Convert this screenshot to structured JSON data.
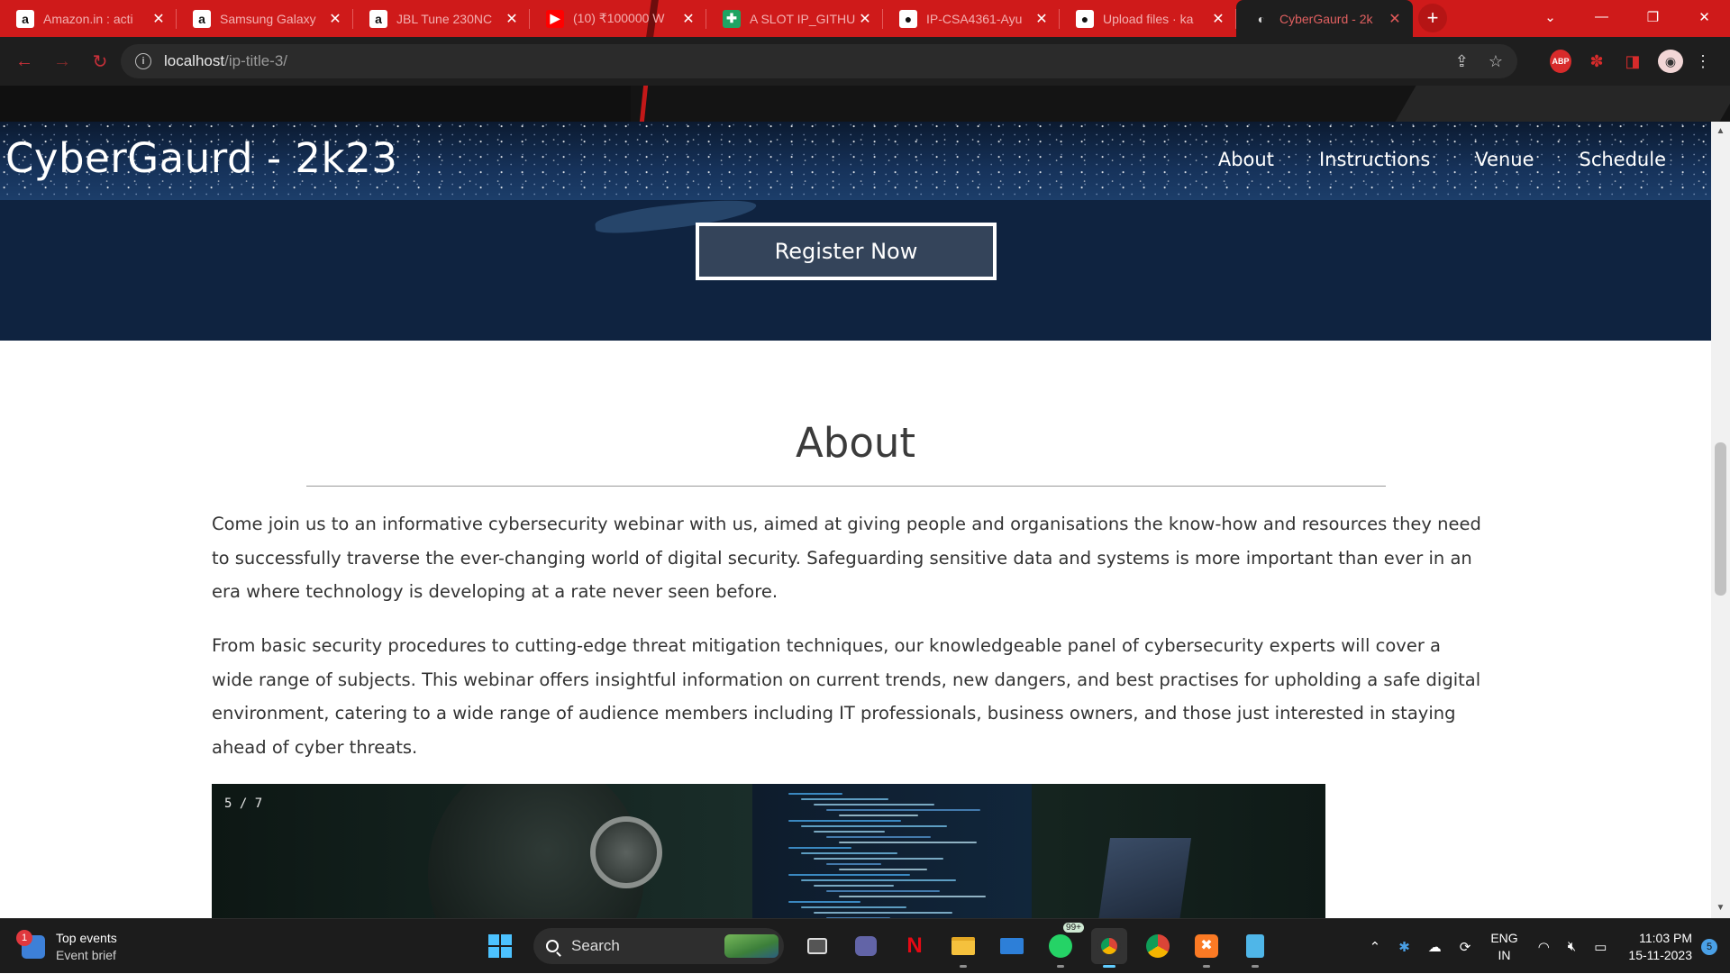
{
  "browser": {
    "tabs": [
      {
        "title": "Amazon.in : acti",
        "favicon": "amazon-icon",
        "fav_bg": "#ffffff",
        "fav_fg": "#111111",
        "glyph": "a"
      },
      {
        "title": "Samsung Galaxy",
        "favicon": "amazon-icon",
        "fav_bg": "#ffffff",
        "fav_fg": "#111111",
        "glyph": "a"
      },
      {
        "title": "JBL Tune 230NC",
        "favicon": "amazon-icon",
        "fav_bg": "#ffffff",
        "fav_fg": "#111111",
        "glyph": "a"
      },
      {
        "title": "(10) ₹100000 W",
        "favicon": "youtube-icon",
        "fav_bg": "#ff0000",
        "fav_fg": "#ffffff",
        "glyph": "▶"
      },
      {
        "title": "A SLOT IP_GITHU",
        "favicon": "sheets-icon",
        "fav_bg": "#1fa463",
        "fav_fg": "#ffffff",
        "glyph": "✚"
      },
      {
        "title": "IP-CSA4361-Ayu",
        "favicon": "github-icon",
        "fav_bg": "#ffffff",
        "fav_fg": "#111111",
        "glyph": "●"
      },
      {
        "title": "Upload files · ka",
        "favicon": "github-icon",
        "fav_bg": "#ffffff",
        "fav_fg": "#111111",
        "glyph": "●"
      },
      {
        "title": "CyberGaurd - 2k",
        "favicon": "page-icon",
        "fav_bg": "transparent",
        "fav_fg": "#dddddd",
        "glyph": "◐",
        "active": true
      }
    ],
    "url_host": "localhost",
    "url_path": "/ip-title-3/",
    "accent": "#cf1a1a"
  },
  "site": {
    "brand": "CyberGaurd - 2k23",
    "nav": [
      "About",
      "Instructions",
      "Venue",
      "Schedule"
    ],
    "register_label": "Register Now"
  },
  "about": {
    "title": "About",
    "paragraphs": [
      "Come join us to an informative cybersecurity webinar with us, aimed at giving people and organisations the know-how and resources they need to successfully traverse the ever-changing world of digital security. Safeguarding sensitive data and systems is more important than ever in an era where technology is developing at a rate never seen before.",
      "From basic security procedures to cutting-edge threat mitigation techniques, our knowledgeable panel of cybersecurity experts will cover a wide range of subjects. This webinar offers insightful information on current trends, new dangers, and best practises for upholding a safe digital environment, catering to a wide range of audience members including IT professionals, business owners, and those just interested in staying ahead of cyber threats."
    ],
    "slide_counter": "5 / 7"
  },
  "taskbar": {
    "widget_title": "Top events",
    "widget_sub": "Event brief",
    "widget_badge": "1",
    "search_label": "Search",
    "whatsapp_badge": "99+",
    "lang_top": "ENG",
    "lang_bottom": "IN",
    "time": "11:03 PM",
    "date": "15-11-2023",
    "notifications": "5"
  }
}
